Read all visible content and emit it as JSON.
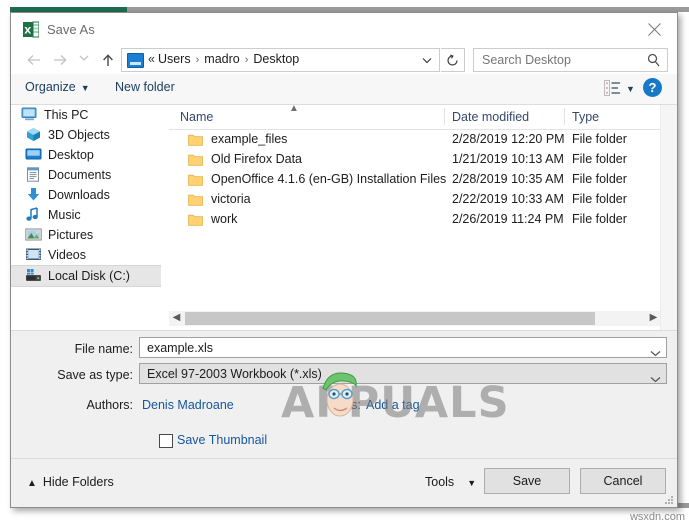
{
  "window": {
    "title": "Save As",
    "app_icon": "excel-icon",
    "close_label": "✕"
  },
  "nav": {
    "back": "back-arrow",
    "forward": "forward-arrow",
    "recent": "recent-locations-chevron",
    "up": "up-arrow",
    "address": {
      "icon": "desktop-icon",
      "prefix": "«",
      "crumbs": [
        "Users",
        "madro",
        "Desktop"
      ],
      "separator": "›",
      "dropdown": "chevron-down-icon"
    },
    "refresh": "refresh-icon",
    "search": {
      "placeholder": "Search Desktop",
      "icon": "search-icon"
    }
  },
  "toolbar": {
    "organize": "Organize",
    "new_folder": "New folder",
    "view_icon": "view-layout-icon",
    "help_label": "?"
  },
  "sidebar": {
    "items": [
      {
        "label": "This PC",
        "icon": "this-pc-icon",
        "level": 0,
        "selected": false
      },
      {
        "label": "3D Objects",
        "icon": "3d-objects-icon",
        "level": 1,
        "selected": false
      },
      {
        "label": "Desktop",
        "icon": "desktop-icon",
        "level": 1,
        "selected": false
      },
      {
        "label": "Documents",
        "icon": "documents-icon",
        "level": 1,
        "selected": false
      },
      {
        "label": "Downloads",
        "icon": "downloads-icon",
        "level": 1,
        "selected": false
      },
      {
        "label": "Music",
        "icon": "music-icon",
        "level": 1,
        "selected": false
      },
      {
        "label": "Pictures",
        "icon": "pictures-icon",
        "level": 1,
        "selected": false
      },
      {
        "label": "Videos",
        "icon": "videos-icon",
        "level": 1,
        "selected": false
      },
      {
        "label": "Local Disk (C:)",
        "icon": "local-disk-icon",
        "level": 1,
        "selected": true
      }
    ]
  },
  "file_list": {
    "columns": [
      "Name",
      "Date modified",
      "Type"
    ],
    "sort_indicator": "ascending",
    "rows": [
      {
        "name": "example_files",
        "date": "2/28/2019 12:20 PM",
        "type": "File folder",
        "icon": "folder-icon"
      },
      {
        "name": "Old Firefox Data",
        "date": "1/21/2019 10:13 AM",
        "type": "File folder",
        "icon": "folder-icon"
      },
      {
        "name": "OpenOffice 4.1.6 (en-GB) Installation Files",
        "date": "2/28/2019 10:35 AM",
        "type": "File folder",
        "icon": "folder-icon"
      },
      {
        "name": "victoria",
        "date": "2/22/2019 10:33 AM",
        "type": "File folder",
        "icon": "folder-icon"
      },
      {
        "name": "work",
        "date": "2/26/2019 11:24 PM",
        "type": "File folder",
        "icon": "folder-icon"
      }
    ]
  },
  "form": {
    "filename_label": "File name:",
    "filename_value": "example.xls",
    "savetype_label": "Save as type:",
    "savetype_value": "Excel 97-2003 Workbook (*.xls)",
    "authors_label": "Authors:",
    "authors_value": "Denis Madroane",
    "tags_label": "Tags:",
    "tags_value": "Add a tag",
    "thumbnail_label": "Save Thumbnail",
    "thumbnail_checked": false
  },
  "footer": {
    "hide_folders": "Hide Folders",
    "tools": "Tools",
    "save": "Save",
    "cancel": "Cancel"
  },
  "watermarks": {
    "brand": "APPUALS",
    "site": "wsxdn.com"
  },
  "colors": {
    "accent_blue": "#16569c",
    "excel_green": "#1e6b4f",
    "help_blue": "#1878c8",
    "folder_yellow": "#ffd271"
  }
}
